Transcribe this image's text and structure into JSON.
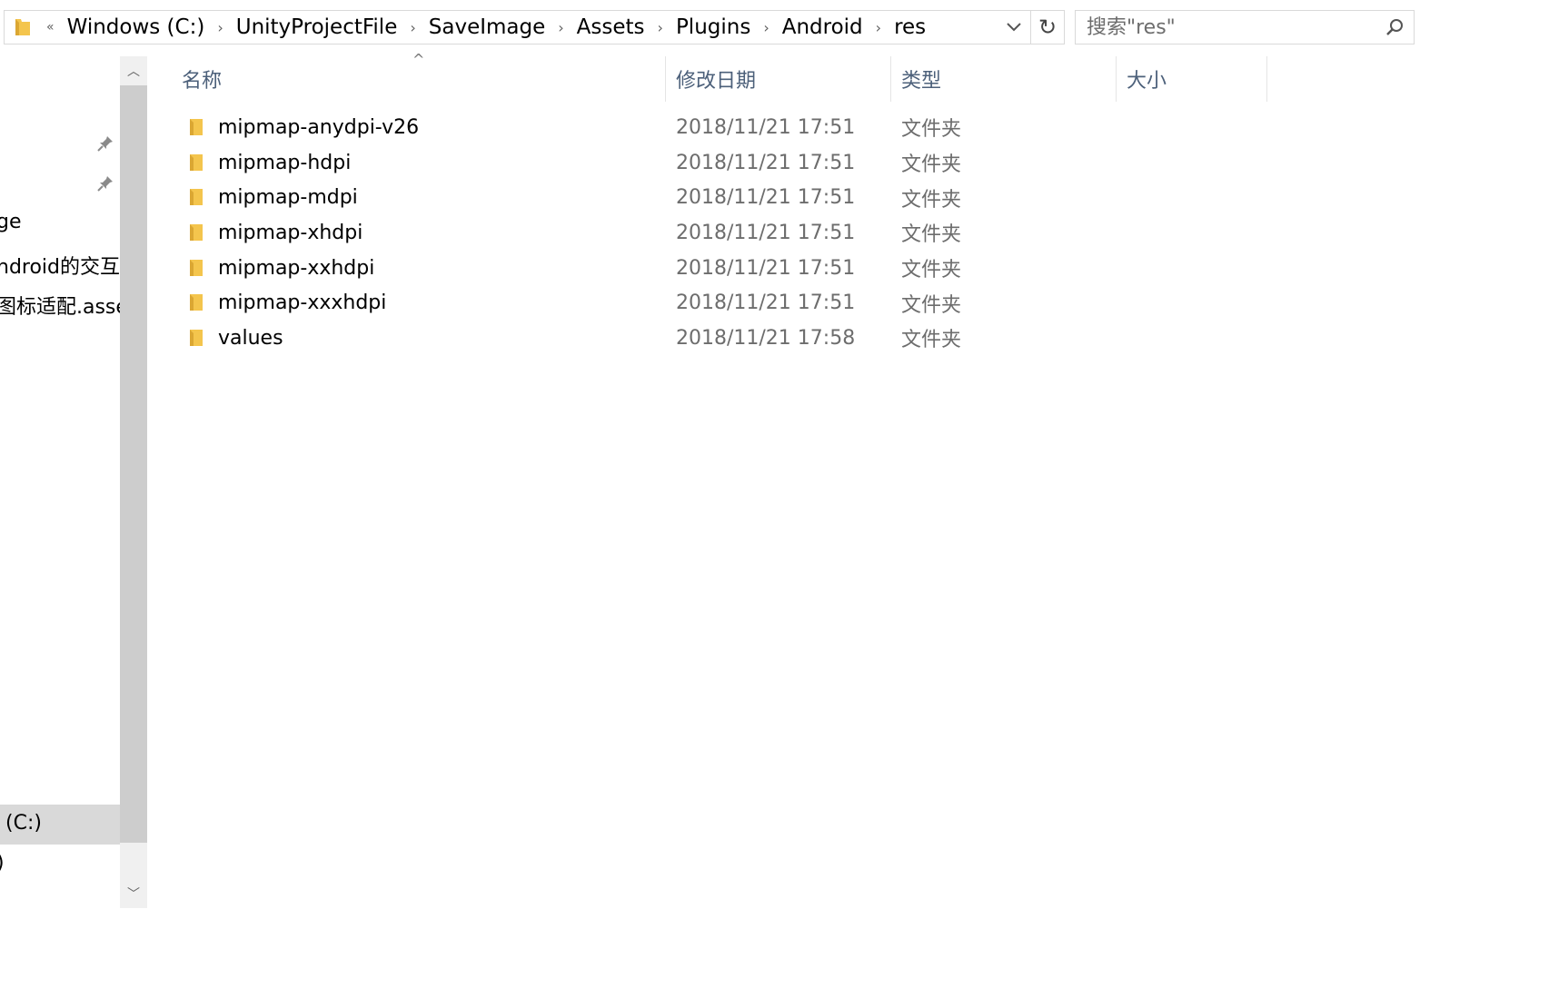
{
  "address_bar": {
    "overflow_glyph": "«",
    "crumbs": [
      "Windows (C:)",
      "UnityProjectFile",
      "SaveImage",
      "Assets",
      "Plugins",
      "Android",
      "res"
    ]
  },
  "search": {
    "placeholder": "搜索\"res\""
  },
  "nav": {
    "items": [
      {
        "label": "ge"
      },
      {
        "label": "ndroid的交互"
      },
      {
        "label": "图标适配.asse"
      },
      {
        "label": "(C:)"
      },
      {
        "label": ")"
      }
    ]
  },
  "columns": {
    "name": "名称",
    "date": "修改日期",
    "type": "类型",
    "size": "大小"
  },
  "files": [
    {
      "name": "mipmap-anydpi-v26",
      "date": "2018/11/21 17:51",
      "type": "文件夹",
      "size": ""
    },
    {
      "name": "mipmap-hdpi",
      "date": "2018/11/21 17:51",
      "type": "文件夹",
      "size": ""
    },
    {
      "name": "mipmap-mdpi",
      "date": "2018/11/21 17:51",
      "type": "文件夹",
      "size": ""
    },
    {
      "name": "mipmap-xhdpi",
      "date": "2018/11/21 17:51",
      "type": "文件夹",
      "size": ""
    },
    {
      "name": "mipmap-xxhdpi",
      "date": "2018/11/21 17:51",
      "type": "文件夹",
      "size": ""
    },
    {
      "name": "mipmap-xxxhdpi",
      "date": "2018/11/21 17:51",
      "type": "文件夹",
      "size": ""
    },
    {
      "name": "values",
      "date": "2018/11/21 17:58",
      "type": "文件夹",
      "size": ""
    }
  ],
  "colors": {
    "folder": "#f4c54d",
    "folder_dark": "#dba733",
    "header_text": "#4c607a",
    "selected_bg": "#d9d9d9"
  }
}
